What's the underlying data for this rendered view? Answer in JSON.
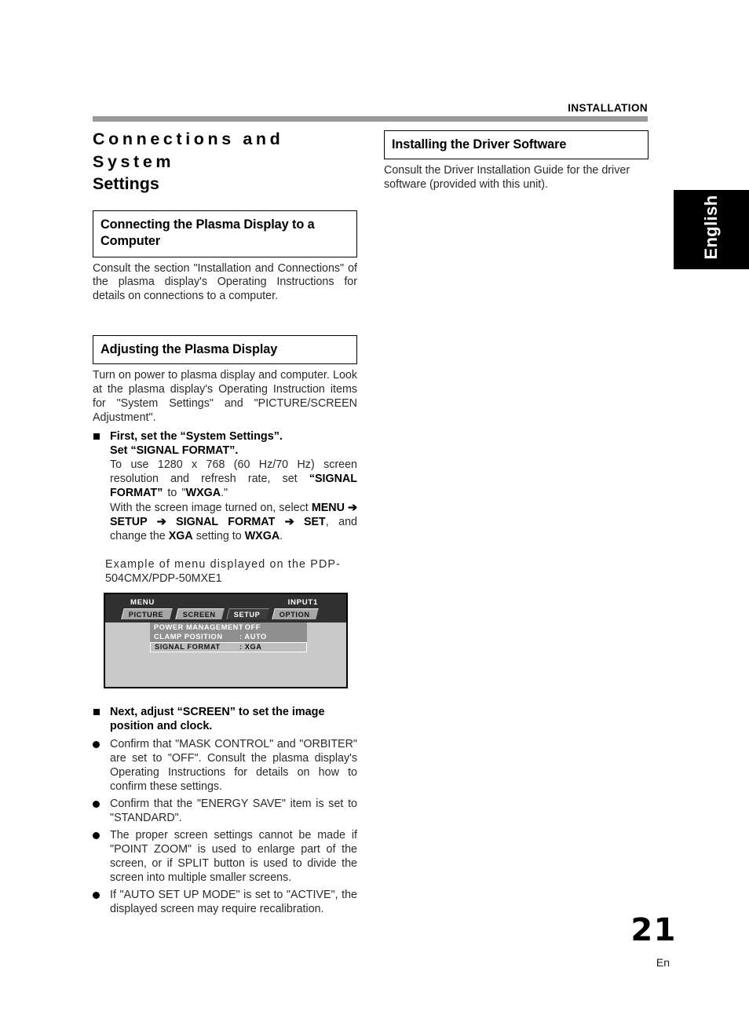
{
  "header": {
    "running_head": "INSTALLATION"
  },
  "left_column": {
    "chapter_title_line1": "Connections and System",
    "chapter_title_line2": "Settings",
    "section1": {
      "heading": "Connecting the Plasma Display to a Computer",
      "body": "Consult the section \"Installation and Connections\" of the plasma display's Operating Instructions for details on connections to a computer."
    },
    "section2": {
      "heading": "Adjusting the Plasma Display",
      "intro": "Turn on power to plasma display and computer. Look at the plasma display's Operating Instruction items for \"System Settings\" and \"PICTURE/SCREEN Adjustment\".",
      "item1": {
        "head_line1": "First, set the “System Settings”.",
        "head_line2": "Set “SIGNAL FORMAT”.",
        "para1_a": "To use 1280 x 768 (60 Hz/70 Hz) screen resolution and refresh rate, set ",
        "para1_b": "“SIGNAL FORMAT”",
        "para1_c": " to \"",
        "para1_d": "WXGA",
        "para1_e": ".\"",
        "para2_a": "With the screen image turned on, select ",
        "para2_b": "MENU",
        "para2_c": " ➔ ",
        "para2_d": "SETUP",
        "para2_e": " ➔ ",
        "para2_f": "SIGNAL FORMAT",
        "para2_g": " ➔ ",
        "para2_h": "SET",
        "para2_i": ", and change the ",
        "para2_j": "XGA",
        "para2_k": " setting to ",
        "para2_l": "WXGA",
        "para2_m": "."
      },
      "caption_line1": "Example of menu displayed on the PDP-",
      "caption_line2": "504CMX/PDP-50MXE1",
      "item2": {
        "head_line1": "Next, adjust “SCREEN” to set the image",
        "head_line2": "position and clock."
      },
      "bullets": [
        "Confirm that \"MASK CONTROL\" and \"ORBITER\" are set to \"OFF\". Consult the plasma display's Operating Instructions for details on how to confirm these settings.",
        "Confirm that the \"ENERGY SAVE\" item is set to \"STANDARD\".",
        "The proper screen settings cannot be made if \"POINT ZOOM\" is used to enlarge part of the screen, or if SPLIT button is used to divide the screen into multiple smaller screens.",
        "If \"AUTO SET UP MODE\" is set to \"ACTIVE\", the displayed screen may require recalibration."
      ]
    }
  },
  "osd": {
    "title": "MENU",
    "input": "INPUT1",
    "tabs": [
      {
        "label": "PICTURE",
        "selected": false
      },
      {
        "label": "SCREEN",
        "selected": false
      },
      {
        "label": "SETUP",
        "selected": true
      },
      {
        "label": "OPTION",
        "selected": false
      }
    ],
    "rows": [
      {
        "label": "POWER MANAGEMENT",
        "value": ": OFF",
        "highlighted": false
      },
      {
        "label": "CLAMP POSITION",
        "value": ": AUTO",
        "highlighted": false
      },
      {
        "label": "SIGNAL FORMAT",
        "value": ": XGA",
        "highlighted": true
      }
    ]
  },
  "right_column": {
    "section1": {
      "heading": "Installing the Driver Software",
      "body": "Consult the Driver Installation Guide for the driver software (provided with this unit)."
    }
  },
  "lang_tab": {
    "label": "English"
  },
  "folio": {
    "page_number": "21",
    "language_code": "En"
  }
}
